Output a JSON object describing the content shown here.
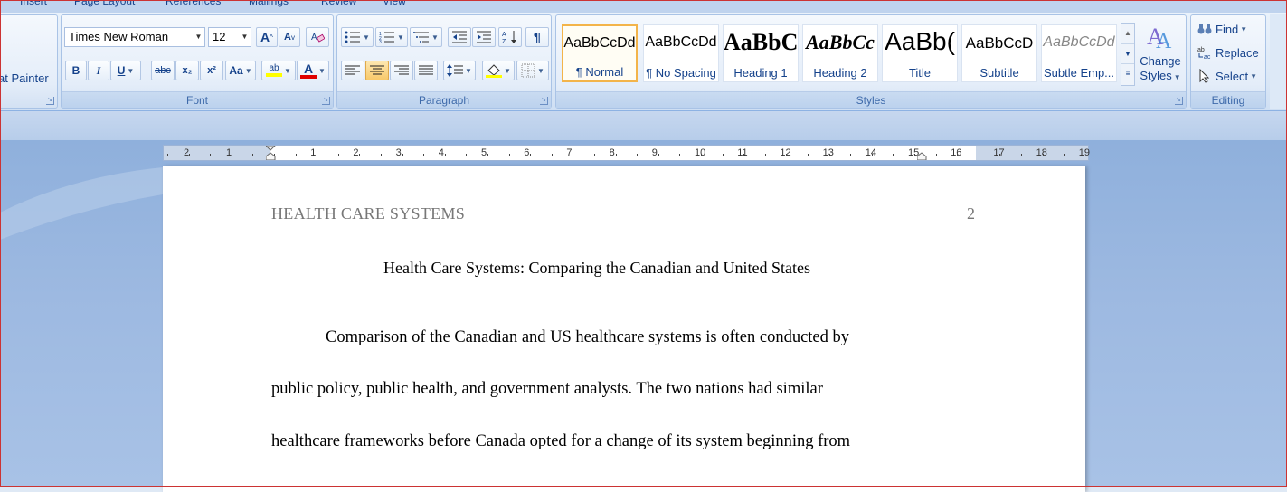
{
  "tabs": [
    "Insert",
    "Page Layout",
    "References",
    "Mailings",
    "Review",
    "View"
  ],
  "clipboard": {
    "format_painter_label": "at Painter"
  },
  "font": {
    "group_label": "Font",
    "family": "Times New Roman",
    "size": "12",
    "grow_label": "A",
    "shrink_label": "A",
    "bold": "B",
    "italic": "I",
    "underline": "U",
    "strikethrough": "abc",
    "subscript": "x₂",
    "superscript": "x²",
    "change_case": "Aa",
    "highlight_label": "ab",
    "font_color_label": "A",
    "highlight_color": "#ffff00",
    "font_color": "#e00000"
  },
  "paragraph": {
    "group_label": "Paragraph",
    "pilcrow": "¶"
  },
  "styles": {
    "group_label": "Styles",
    "items": [
      {
        "sample": "AaBbCcDd",
        "name": "¶ Normal"
      },
      {
        "sample": "AaBbCcDd",
        "name": "¶ No Spacing"
      },
      {
        "sample": "AaBbC",
        "name": "Heading 1"
      },
      {
        "sample": "AaBbCc",
        "name": "Heading 2"
      },
      {
        "sample": "AaBb(",
        "name": "Title"
      },
      {
        "sample": "AaBbCcD",
        "name": "Subtitle"
      },
      {
        "sample": "AaBbCcDd",
        "name": "Subtle Emp..."
      }
    ],
    "change_styles_line1": "Change",
    "change_styles_line2": "Styles"
  },
  "editing": {
    "group_label": "Editing",
    "find": "Find",
    "replace": "Replace",
    "select": "Select"
  },
  "ruler": {
    "left_numbers": [
      "2",
      "1"
    ],
    "right_numbers": [
      "1",
      "2",
      "3",
      "4",
      "5",
      "6",
      "7",
      "8",
      "9",
      "10",
      "11",
      "12",
      "13",
      "14",
      "15",
      "16",
      "17",
      "18",
      "19"
    ]
  },
  "document": {
    "running_head": "HEALTH CARE SYSTEMS",
    "page_number": "2",
    "title": "Health Care Systems: Comparing the Canadian and United States",
    "lines": [
      "Comparison of the Canadian and US healthcare systems is often conducted by",
      "public policy, public health, and government analysts. The two nations had similar",
      "healthcare frameworks before Canada opted for a change of its system beginning from"
    ]
  }
}
